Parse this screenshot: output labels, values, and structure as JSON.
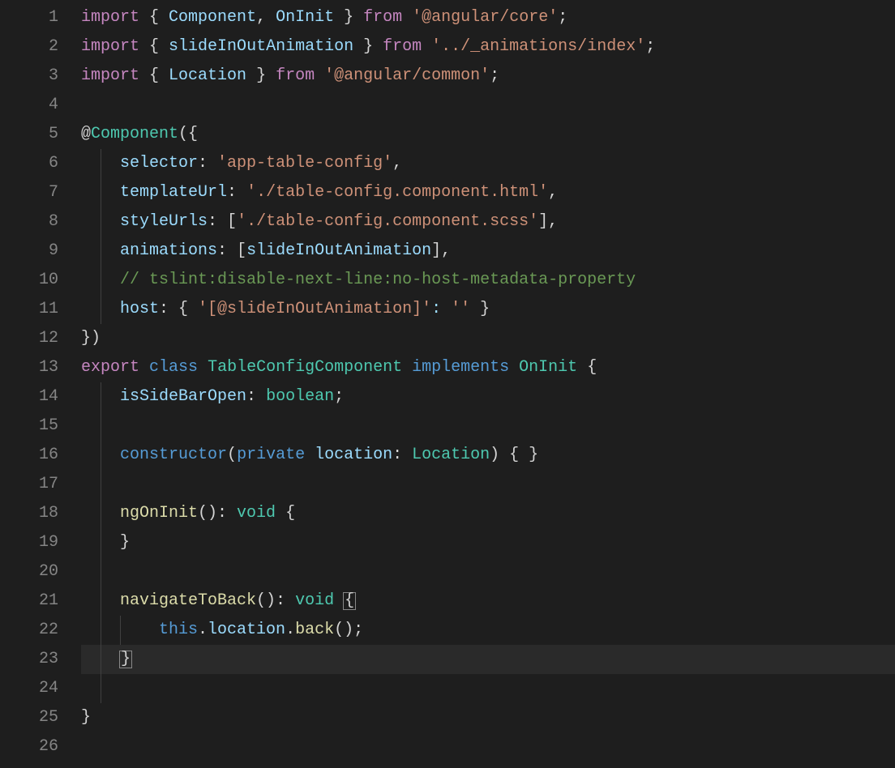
{
  "lineNumbers": [
    "1",
    "2",
    "3",
    "4",
    "5",
    "6",
    "7",
    "8",
    "9",
    "10",
    "11",
    "12",
    "13",
    "14",
    "15",
    "16",
    "17",
    "18",
    "19",
    "20",
    "21",
    "22",
    "23",
    "24",
    "25",
    "26"
  ],
  "code": {
    "l1": {
      "kw1": "import",
      "brace1": "{ ",
      "id1": "Component",
      "comma": ", ",
      "id2": "OnInit",
      "brace2": " }",
      "kw2": "from",
      "str": "'@angular/core'",
      "end": ";"
    },
    "l2": {
      "kw1": "import",
      "brace1": "{ ",
      "id1": "slideInOutAnimation",
      "brace2": " }",
      "kw2": "from",
      "str": "'../_animations/index'",
      "end": ";"
    },
    "l3": {
      "kw1": "import",
      "brace1": "{ ",
      "id1": "Location",
      "brace2": " }",
      "kw2": "from",
      "str": "'@angular/common'",
      "end": ";"
    },
    "l5": {
      "at": "@",
      "dec": "Component",
      "paren": "({"
    },
    "l6": {
      "prop": "selector",
      "colon": ": ",
      "str": "'app-table-config'",
      "end": ","
    },
    "l7": {
      "prop": "templateUrl",
      "colon": ": ",
      "str": "'./table-config.component.html'",
      "end": ","
    },
    "l8": {
      "prop": "styleUrls",
      "colon": ": [",
      "str": "'./table-config.component.scss'",
      "end": "],"
    },
    "l9": {
      "prop": "animations",
      "colon": ": [",
      "id": "slideInOutAnimation",
      "end": "],"
    },
    "l10": {
      "comment": "// tslint:disable-next-line:no-host-metadata-property"
    },
    "l11": {
      "prop": "host",
      "colon": ": { ",
      "key": "'[@slideInOutAnimation]'",
      "sep": ": ",
      "val": "''",
      "end": " }"
    },
    "l12": {
      "close": "})"
    },
    "l13": {
      "kw1": "export",
      "kw2": "class",
      "cls": "TableConfigComponent",
      "kw3": "implements",
      "iface": "OnInit",
      "brace": "{"
    },
    "l14": {
      "prop": "isSideBarOpen",
      "colon": ": ",
      "type": "boolean",
      "end": ";"
    },
    "l16": {
      "kw": "constructor",
      "paren1": "(",
      "mod": "private",
      "name": "location",
      "colon": ": ",
      "type": "Location",
      "paren2": ") { }"
    },
    "l18": {
      "fn": "ngOnInit",
      "paren": "(): ",
      "type": "void",
      "brace": " {"
    },
    "l19": {
      "brace": "}"
    },
    "l21": {
      "fn": "navigateToBack",
      "paren": "(): ",
      "type": "void",
      "brace": "{"
    },
    "l22": {
      "this": "this",
      "dot1": ".",
      "prop": "location",
      "dot2": ".",
      "fn": "back",
      "end": "();"
    },
    "l23": {
      "brace": "}"
    },
    "l25": {
      "brace": "}"
    }
  }
}
